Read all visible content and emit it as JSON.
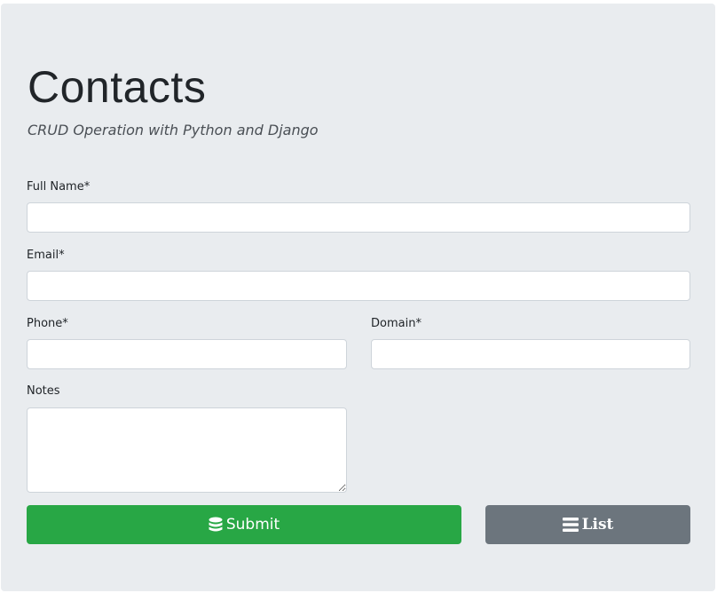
{
  "header": {
    "title": "Contacts",
    "subtitle": "CRUD Operation with Python and Django"
  },
  "form": {
    "full_name": {
      "label": "Full Name*",
      "value": "",
      "placeholder": ""
    },
    "email": {
      "label": "Email*",
      "value": "",
      "placeholder": ""
    },
    "phone": {
      "label": "Phone*",
      "value": "",
      "placeholder": ""
    },
    "domain": {
      "label": "Domain*",
      "value": "",
      "placeholder": ""
    },
    "notes": {
      "label": "Notes",
      "value": "",
      "placeholder": ""
    }
  },
  "actions": {
    "submit_label": "Submit",
    "submit_icon": "database-icon",
    "list_label": "List",
    "list_icon": "list-icon"
  },
  "colors": {
    "background": "#e9ecef",
    "submit": "#28a745",
    "list": "#6c757d"
  }
}
